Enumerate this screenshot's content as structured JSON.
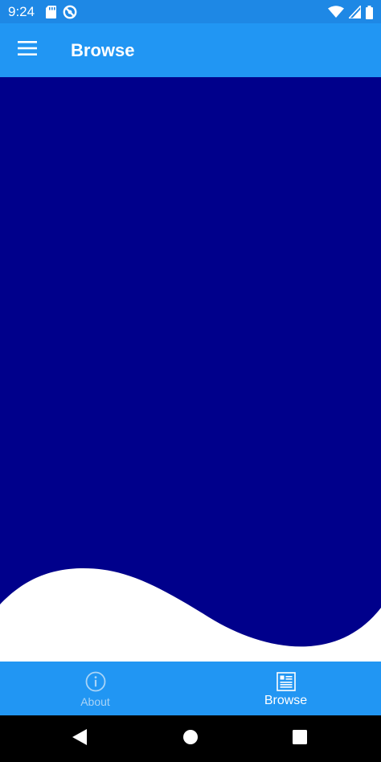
{
  "status_bar": {
    "time": "9:24",
    "icons": [
      "sd-card-icon",
      "do-not-disturb-icon",
      "wifi-icon",
      "signal-icon",
      "battery-icon"
    ]
  },
  "app_bar": {
    "title": "Browse",
    "menu_icon": "hamburger-menu-icon"
  },
  "content": {
    "background_color": "#00008b",
    "wave_color": "#ffffff"
  },
  "tabs": [
    {
      "label": "About",
      "icon": "info-icon",
      "selected": false
    },
    {
      "label": "Browse",
      "icon": "list-icon",
      "selected": true
    }
  ],
  "nav_bar": {
    "buttons": [
      "back-icon",
      "home-icon",
      "recents-icon"
    ]
  },
  "colors": {
    "status_bar": "#1e88e5",
    "primary": "#2196f3",
    "content_fill": "#00008b",
    "tab_inactive": "#a9d4f7",
    "tab_active": "#ffffff"
  }
}
